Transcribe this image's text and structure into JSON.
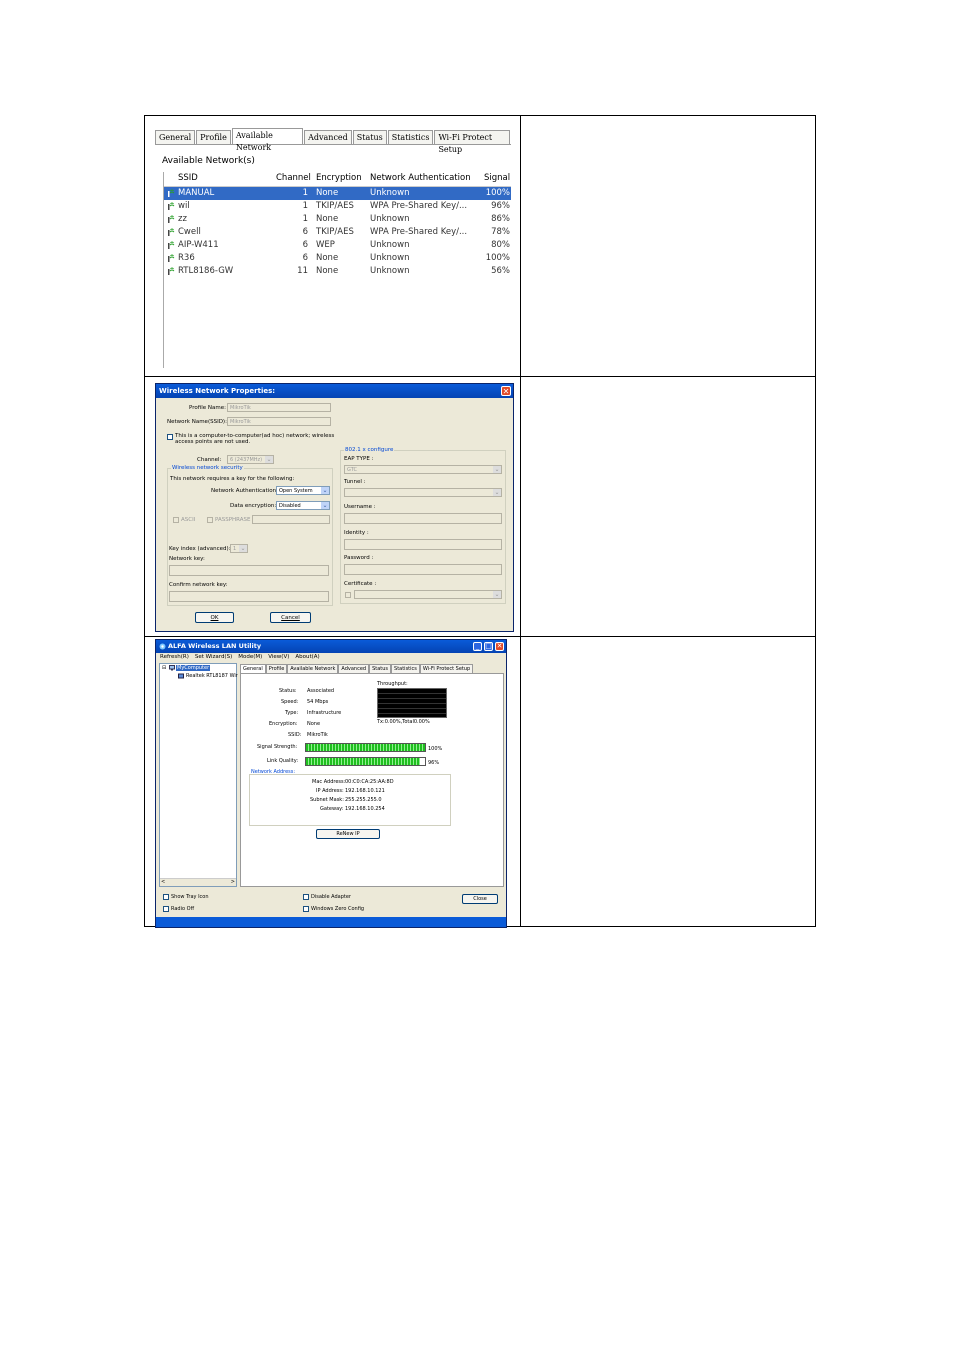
{
  "panel1": {
    "tabs": [
      "General",
      "Profile",
      "Available Network",
      "Advanced",
      "Status",
      "Statistics",
      "Wi-Fi Protect Setup"
    ],
    "active_tab": 2,
    "title": "Available Network(s)",
    "columns": [
      "SSID",
      "Channel",
      "Encryption",
      "Network Authentication",
      "Signal"
    ],
    "rows": [
      {
        "ssid": "MANUAL",
        "channel": "1",
        "enc": "None",
        "auth": "Unknown",
        "signal": "100%",
        "selected": true
      },
      {
        "ssid": "wil",
        "channel": "1",
        "enc": "TKIP/AES",
        "auth": "WPA Pre-Shared Key/...",
        "signal": "96%"
      },
      {
        "ssid": "zz",
        "channel": "1",
        "enc": "None",
        "auth": "Unknown",
        "signal": "86%"
      },
      {
        "ssid": "Cwell",
        "channel": "6",
        "enc": "TKIP/AES",
        "auth": "WPA Pre-Shared Key/...",
        "signal": "78%"
      },
      {
        "ssid": "AIP-W411",
        "channel": "6",
        "enc": "WEP",
        "auth": "Unknown",
        "signal": "80%"
      },
      {
        "ssid": "R36",
        "channel": "6",
        "enc": "None",
        "auth": "Unknown",
        "signal": "100%"
      },
      {
        "ssid": "RTL8186-GW",
        "channel": "11",
        "enc": "None",
        "auth": "Unknown",
        "signal": "56%"
      }
    ]
  },
  "panel2": {
    "window_title": "Wireless Network Properties:",
    "close_glyph": "✕",
    "profile_name_label": "Profile Name:",
    "profile_name_value": "MikroTik",
    "ssid_label": "Network Name(SSID):",
    "ssid_value": "MikroTik",
    "adhoc_line1": "This is a computer-to-computer(ad hoc) network; wireless",
    "adhoc_line2": "access points are not used.",
    "channel_label": "Channel:",
    "channel_value": "6 (2437MHz)",
    "security_group": "Wireless network security",
    "requires_key": "This network requires a key for the following:",
    "auth_label": "Network Authentication:",
    "auth_value": "Open System",
    "enc_label": "Data encryption:",
    "enc_value": "Disabled",
    "ascii_label": "ASCII",
    "passphrase_label": "PASSPHRASE",
    "key_index_label": "Key index (advanced):",
    "key_index_value": "1",
    "network_key_label": "Network key:",
    "confirm_key_label": "Confirm network key:",
    "x8021_group": "802.1 x configure",
    "eap_label": "EAP TYPE :",
    "eap_value": "GTC",
    "tunnel_label": "Tunnel :",
    "username_label": "Username :",
    "identity_label": "Identity :",
    "password_label": "Password :",
    "certificate_label": "Certificate :",
    "ok_label": "OK",
    "cancel_label": "Cancel",
    "dropdown_glyph": "⌄"
  },
  "panel3": {
    "window_title": "ALFA Wireless LAN Utility",
    "minimize_glyph": "_",
    "maximize_glyph": "□",
    "close_glyph": "✕",
    "menu": [
      "Refresh(R)",
      "Set Wizard(S)",
      "Mode(M)",
      "View(V)",
      "About(A)"
    ],
    "tree_root": "MyComputer",
    "tree_child": "Realtek RTL8187 Wir",
    "tree_expander": "⊟",
    "tabs": [
      "General",
      "Profile",
      "Available Network",
      "Advanced",
      "Status",
      "Statistics",
      "Wi-Fi Protect Setup"
    ],
    "active_tab": 0,
    "status_label": "Status:",
    "status_value": "Associated",
    "speed_label": "Speed:",
    "speed_value": "54 Mbps",
    "type_label": "Type:",
    "type_value": "Infrastructure",
    "encryption_label": "Encryption:",
    "encryption_value": "None",
    "ssid_label": "SSID:",
    "ssid_value": "MikroTik",
    "signal_label": "Signal Strength:",
    "signal_value": "100%",
    "signal_fraction": 1.0,
    "quality_label": "Link Quality:",
    "quality_value": "96%",
    "quality_fraction": 0.96,
    "throughput_label": "Throughput:",
    "throughput_readout": "Tx:0.00%,Total0.00%",
    "network_address_label": "Network Address:",
    "mac_label": "Mac Address:",
    "mac_value": "00:C0:CA:25:AA:8D",
    "ip_label": "IP Address:",
    "ip_value": "192.168.10.121",
    "subnet_label": "Subnet Mask:",
    "subnet_value": "255.255.255.0",
    "gateway_label": "Gateway:",
    "gateway_value": "192.168.10.254",
    "renew_label": "ReNew IP",
    "show_tray_label": "Show Tray Icon",
    "radio_off_label": "Radio Off",
    "disable_adapter_label": "Disable Adapter",
    "zero_config_label": "Windows Zero Config",
    "close_label": "Close",
    "scroll_left": "<",
    "scroll_right": ">"
  }
}
